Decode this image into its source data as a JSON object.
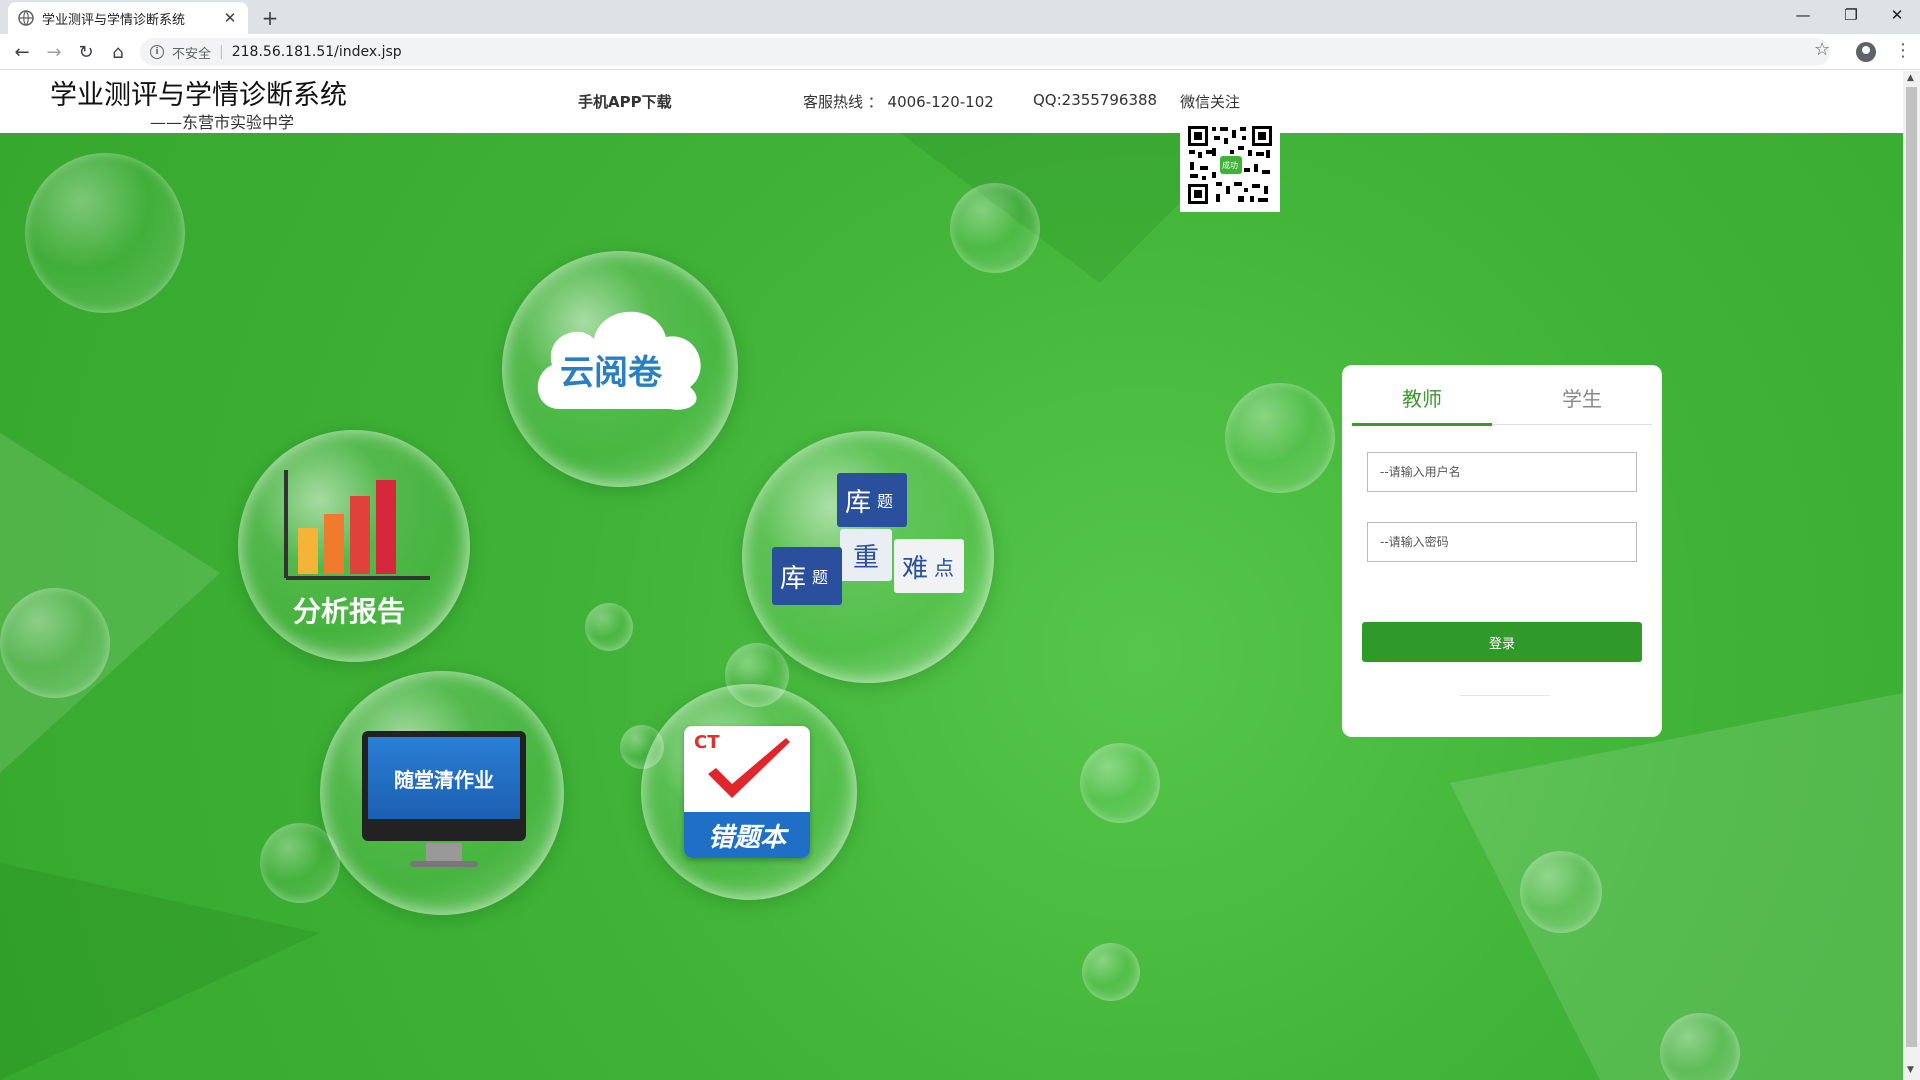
{
  "browser": {
    "tab_title": "学业测评与学情诊断系统",
    "tab_close": "✕",
    "new_tab": "+",
    "security_label": "不安全",
    "url": "218.56.181.51/index.jsp"
  },
  "header": {
    "title": "学业测评与学情诊断系统",
    "subtitle": "——东营市实验中学",
    "app_download": "手机APP下载",
    "hotline": "客服热线 ： 4006-120-102",
    "qq": "QQ:2355796388",
    "wechat": "微信关注",
    "qr_badge": "成功"
  },
  "features": {
    "cloud_marking": "云阅卷",
    "analysis_report": "分析报告",
    "question_bank": {
      "k1": "库",
      "k2": "题",
      "k3": "重",
      "k4": "难",
      "k5": "点",
      "k6": "库",
      "k7": "题"
    },
    "homework": "随堂清作业",
    "mistakes": {
      "ct": "CT",
      "label": "错题本"
    }
  },
  "login": {
    "tab_teacher": "教师",
    "tab_student": "学生",
    "username_placeholder": "--请输入用户名",
    "password_placeholder": "--请输入密码",
    "submit_label": "登录"
  },
  "colors": {
    "background_green": "#3fb337",
    "accent_green": "#2f9a2a"
  }
}
